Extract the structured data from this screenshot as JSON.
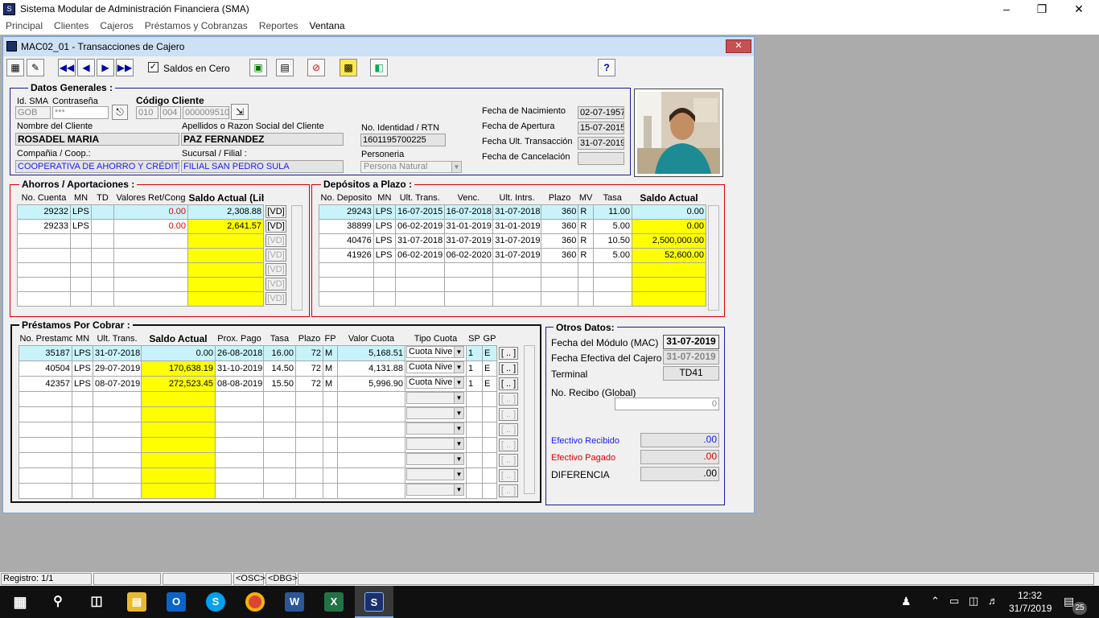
{
  "app": {
    "title": "Sistema Modular de Administración Financiera (SMA)",
    "menu": [
      "Principal",
      "Clientes",
      "Cajeros",
      "Préstamos y Cobranzas",
      "Reportes",
      "Ventana"
    ]
  },
  "window": {
    "title": "MAC02_01 - Transacciones de Cajero",
    "saldos_en_cero": "Saldos en Cero",
    "help": "?"
  },
  "datos_generales": {
    "title": "Datos Generales :",
    "id_sma_label": "Id. SMA",
    "contrasena_label": "Contraseña",
    "id_sma": "GOB",
    "contrasena": "***",
    "codigo_cliente_label": "Código Cliente",
    "codigo_1": "010",
    "codigo_2": "004",
    "codigo_3": "000009510",
    "nombre_label": "Nombre del Cliente",
    "nombre": "ROSADEL MARIA",
    "apellidos_label": "Apellidos o Razon Social del Cliente",
    "apellidos": "PAZ FERNANDEZ",
    "identidad_label": "No. Identidad / RTN",
    "identidad": "1601195700225",
    "compania_label": "Compañia / Coop.:",
    "compania": "COOPERATIVA DE AHORRO Y CRÉDITO",
    "sucursal_label": "Sucursal / Filial :",
    "sucursal": "FILIAL SAN PEDRO SULA",
    "personeria_label": "Personeria",
    "personeria": "Persona Natural",
    "fecha_nacimiento_label": "Fecha de Nacimiento",
    "fecha_nacimiento": "02-07-1957",
    "fecha_apertura_label": "Fecha de  Apertura",
    "fecha_apertura": "15-07-2015",
    "fecha_ult_label": "Fecha Ult. Transacción",
    "fecha_ult": "31-07-2019",
    "fecha_cancel_label": "Fecha de Cancelación",
    "fecha_cancel": ""
  },
  "ahorros": {
    "title": "Ahorros / Aportaciones :",
    "headers": [
      "No. Cuenta",
      "MN",
      "TD",
      "Valores Ret/Cong",
      "Saldo Actual (Lib)"
    ],
    "rows": [
      {
        "cuenta": "29232",
        "mn": "LPS",
        "td": "",
        "valores": "0.00",
        "saldo": "2,308.88",
        "vd": "[VD]"
      },
      {
        "cuenta": "29233",
        "mn": "LPS",
        "td": "",
        "valores": "0.00",
        "saldo": "2,641.57",
        "vd": "[VD]"
      },
      {
        "cuenta": "",
        "mn": "",
        "td": "",
        "valores": "",
        "saldo": "",
        "vd": "[VD]"
      },
      {
        "cuenta": "",
        "mn": "",
        "td": "",
        "valores": "",
        "saldo": "",
        "vd": "[VD]"
      },
      {
        "cuenta": "",
        "mn": "",
        "td": "",
        "valores": "",
        "saldo": "",
        "vd": "[VD]"
      },
      {
        "cuenta": "",
        "mn": "",
        "td": "",
        "valores": "",
        "saldo": "",
        "vd": "[VD]"
      },
      {
        "cuenta": "",
        "mn": "",
        "td": "",
        "valores": "",
        "saldo": "",
        "vd": "[VD]"
      }
    ]
  },
  "depositos": {
    "title": "Depósitos a Plazo :",
    "headers": [
      "No. Deposito",
      "MN",
      "Ult. Trans.",
      "Venc.",
      "Ult. Intrs.",
      "Plazo",
      "MV",
      "Tasa",
      "Saldo Actual"
    ],
    "rows": [
      {
        "no": "29243",
        "mn": "LPS",
        "ult": "16-07-2015",
        "venc": "16-07-2018",
        "intrs": "31-07-2018",
        "plazo": "360",
        "mv": "R",
        "tasa": "11.00",
        "saldo": "0.00"
      },
      {
        "no": "38899",
        "mn": "LPS",
        "ult": "06-02-2019",
        "venc": "31-01-2019",
        "intrs": "31-01-2019",
        "plazo": "360",
        "mv": "R",
        "tasa": "5.00",
        "saldo": "0.00"
      },
      {
        "no": "40476",
        "mn": "LPS",
        "ult": "31-07-2018",
        "venc": "31-07-2019",
        "intrs": "31-07-2019",
        "plazo": "360",
        "mv": "R",
        "tasa": "10.50",
        "saldo": "2,500,000.00"
      },
      {
        "no": "41926",
        "mn": "LPS",
        "ult": "06-02-2019",
        "venc": "06-02-2020",
        "intrs": "31-07-2019",
        "plazo": "360",
        "mv": "R",
        "tasa": "5.00",
        "saldo": "52,600.00"
      },
      {
        "no": "",
        "mn": "",
        "ult": "",
        "venc": "",
        "intrs": "",
        "plazo": "",
        "mv": "",
        "tasa": "",
        "saldo": ""
      },
      {
        "no": "",
        "mn": "",
        "ult": "",
        "venc": "",
        "intrs": "",
        "plazo": "",
        "mv": "",
        "tasa": "",
        "saldo": ""
      },
      {
        "no": "",
        "mn": "",
        "ult": "",
        "venc": "",
        "intrs": "",
        "plazo": "",
        "mv": "",
        "tasa": "",
        "saldo": ""
      }
    ]
  },
  "prestamos": {
    "title": "Préstamos Por Cobrar :",
    "headers": [
      "No. Prestamo",
      "MN",
      "Ult. Trans.",
      "Saldo Actual",
      "Prox. Pago",
      "Tasa",
      "Plazo",
      "FP",
      "Valor Cuota",
      "Tipo Cuota",
      "SP",
      "GP"
    ],
    "rows": [
      {
        "no": "35187",
        "mn": "LPS",
        "ult": "31-07-2018",
        "saldo": "0.00",
        "prox": "26-08-2018",
        "tasa": "16.00",
        "plazo": "72",
        "fp": "M",
        "cuota": "5,168.51",
        "tipo": "Cuota Nive",
        "sp": "1",
        "gp": "E",
        "btn": "[ .. ]"
      },
      {
        "no": "40504",
        "mn": "LPS",
        "ult": "29-07-2019",
        "saldo": "170,638.19",
        "prox": "31-10-2019",
        "tasa": "14.50",
        "plazo": "72",
        "fp": "M",
        "cuota": "4,131.88",
        "tipo": "Cuota Nive",
        "sp": "1",
        "gp": "E",
        "btn": "[ .. ]"
      },
      {
        "no": "42357",
        "mn": "LPS",
        "ult": "08-07-2019",
        "saldo": "272,523.45",
        "prox": "08-08-2019",
        "tasa": "15.50",
        "plazo": "72",
        "fp": "M",
        "cuota": "5,996.90",
        "tipo": "Cuota Nive",
        "sp": "1",
        "gp": "E",
        "btn": "[ .. ]"
      },
      {
        "no": "",
        "mn": "",
        "ult": "",
        "saldo": "",
        "prox": "",
        "tasa": "",
        "plazo": "",
        "fp": "",
        "cuota": "",
        "tipo": "",
        "sp": "",
        "gp": "",
        "btn": "[ .. ]"
      },
      {
        "no": "",
        "mn": "",
        "ult": "",
        "saldo": "",
        "prox": "",
        "tasa": "",
        "plazo": "",
        "fp": "",
        "cuota": "",
        "tipo": "",
        "sp": "",
        "gp": "",
        "btn": "[ .. ]"
      },
      {
        "no": "",
        "mn": "",
        "ult": "",
        "saldo": "",
        "prox": "",
        "tasa": "",
        "plazo": "",
        "fp": "",
        "cuota": "",
        "tipo": "",
        "sp": "",
        "gp": "",
        "btn": "[ .. ]"
      },
      {
        "no": "",
        "mn": "",
        "ult": "",
        "saldo": "",
        "prox": "",
        "tasa": "",
        "plazo": "",
        "fp": "",
        "cuota": "",
        "tipo": "",
        "sp": "",
        "gp": "",
        "btn": "[ .. ]"
      },
      {
        "no": "",
        "mn": "",
        "ult": "",
        "saldo": "",
        "prox": "",
        "tasa": "",
        "plazo": "",
        "fp": "",
        "cuota": "",
        "tipo": "",
        "sp": "",
        "gp": "",
        "btn": "[ .. ]"
      },
      {
        "no": "",
        "mn": "",
        "ult": "",
        "saldo": "",
        "prox": "",
        "tasa": "",
        "plazo": "",
        "fp": "",
        "cuota": "",
        "tipo": "",
        "sp": "",
        "gp": "",
        "btn": "[ .. ]"
      },
      {
        "no": "",
        "mn": "",
        "ult": "",
        "saldo": "",
        "prox": "",
        "tasa": "",
        "plazo": "",
        "fp": "",
        "cuota": "",
        "tipo": "",
        "sp": "",
        "gp": "",
        "btn": "[ .. ]"
      }
    ]
  },
  "otros": {
    "title": "Otros Datos:",
    "fecha_modulo_label": "Fecha del Módulo (MAC)",
    "fecha_modulo": "31-07-2019",
    "fecha_efectiva_label": "Fecha Efectiva del Cajero",
    "fecha_efectiva": "31-07-2019",
    "terminal_label": "Terminal",
    "terminal": "TD41",
    "recibo_label": "No. Recibo (Global)",
    "recibo": "0",
    "efectivo_recibido_label": "Efectivo Recibido",
    "efectivo_recibido": ".00",
    "efectivo_pagado_label": "Efectivo Pagado",
    "efectivo_pagado": ".00",
    "diferencia_label": "DIFERENCIA",
    "diferencia": ".00"
  },
  "status": {
    "registro": "Registro: 1/1",
    "osc": "<OSC>",
    "dbg": "<DBG>"
  },
  "taskbar": {
    "time": "12:32",
    "date": "31/7/2019",
    "notifications": "25"
  },
  "colors": {
    "cyan_cell": "#c9f3fb",
    "yellow_cell": "#ffff00",
    "red_text": "#e00000",
    "blue_text": "#1a1aff",
    "group_red": "#d00000",
    "group_blue": "#1a1a9a"
  }
}
